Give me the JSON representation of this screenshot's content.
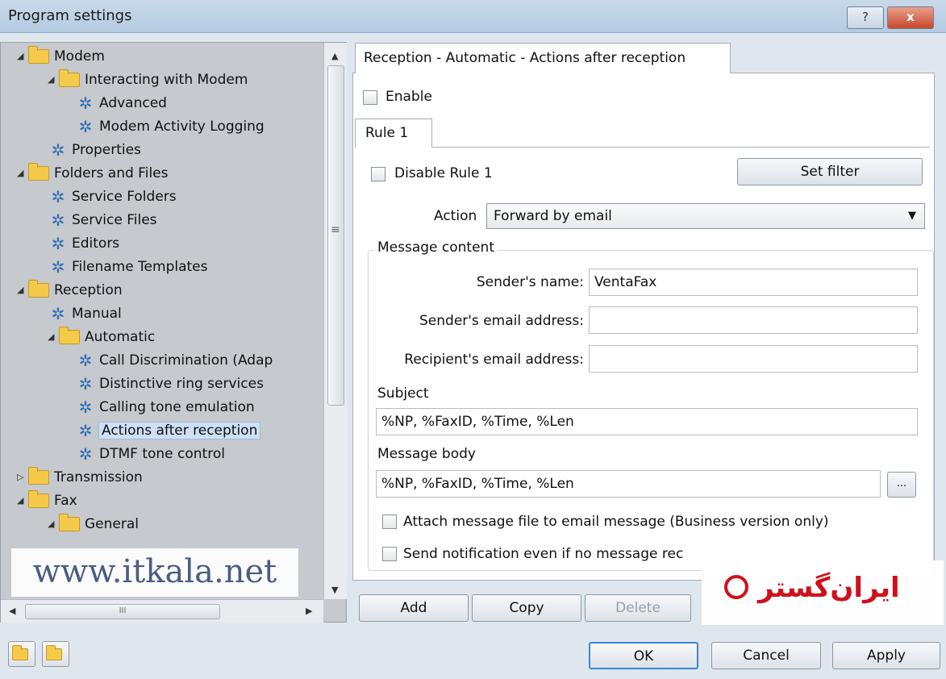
{
  "window": {
    "title": "Program settings",
    "help_label": "?",
    "close_label": "x"
  },
  "tree": {
    "items": [
      {
        "label": "Modem",
        "kind": "folder",
        "expander": "◢"
      },
      {
        "label": "Interacting with Modem",
        "kind": "folder",
        "expander": "◢"
      },
      {
        "label": "Advanced",
        "kind": "gear"
      },
      {
        "label": "Modem Activity Logging",
        "kind": "gear"
      },
      {
        "label": "Properties",
        "kind": "gear"
      },
      {
        "label": "Folders and Files",
        "kind": "folder",
        "expander": "◢"
      },
      {
        "label": "Service Folders",
        "kind": "gear"
      },
      {
        "label": "Service Files",
        "kind": "gear"
      },
      {
        "label": "Editors",
        "kind": "gear"
      },
      {
        "label": "Filename Templates",
        "kind": "gear"
      },
      {
        "label": "Reception",
        "kind": "folder",
        "expander": "◢"
      },
      {
        "label": "Manual",
        "kind": "gear"
      },
      {
        "label": "Automatic",
        "kind": "folder",
        "expander": "◢"
      },
      {
        "label": "Call Discrimination (Adap",
        "kind": "gear"
      },
      {
        "label": "Distinctive ring services",
        "kind": "gear"
      },
      {
        "label": "Calling tone emulation",
        "kind": "gear"
      },
      {
        "label": "Actions after reception",
        "kind": "gear",
        "selected": true
      },
      {
        "label": "DTMF tone control",
        "kind": "gear"
      },
      {
        "label": "Transmission",
        "kind": "folder",
        "expander": "▷"
      },
      {
        "label": "Fax",
        "kind": "folder",
        "expander": "◢"
      },
      {
        "label": "General",
        "kind": "folder",
        "expander": "◢"
      }
    ],
    "scroll_grip": "≡",
    "hscroll_grip": "III"
  },
  "watermark": "www.itkala.net",
  "main": {
    "tab_label": "Reception - Automatic - Actions after reception",
    "enable_label": "Enable",
    "rule_tab": "Rule 1",
    "disable_rule_label": "Disable Rule 1",
    "set_filter_label": "Set filter",
    "action_label": "Action",
    "action_value": "Forward by email",
    "group_title": "Message content",
    "sender_name_label": "Sender's name:",
    "sender_name_value": "VentaFax",
    "sender_email_label": "Sender's email address:",
    "sender_email_value": "",
    "recipient_email_label": "Recipient's email address:",
    "recipient_email_value": "",
    "subject_label": "Subject",
    "subject_value": "%NP, %FaxID, %Time, %Len",
    "body_label": "Message body",
    "body_value": "%NP, %FaxID, %Time, %Len",
    "browse_label": "...",
    "attach_label": "Attach message file to email message (Business version only)",
    "notify_label": "Send notification even if no message rec",
    "add_label": "Add",
    "copy_label": "Copy",
    "delete_label": "Delete"
  },
  "logo_text": "ایران‌گستر",
  "footer": {
    "ok_label": "OK",
    "cancel_label": "Cancel",
    "apply_label": "Apply"
  },
  "colors": {
    "selection": "#cde0f5",
    "logo_red": "#d0101a",
    "watermark": "#4a5d83"
  }
}
